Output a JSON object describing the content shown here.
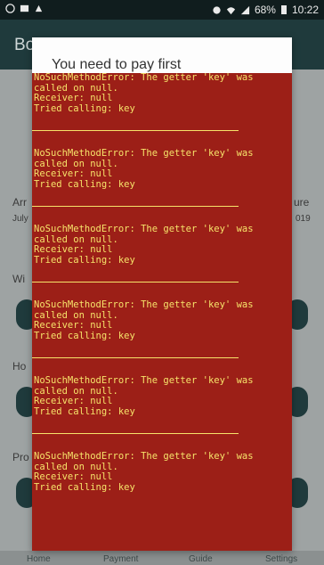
{
  "status_bar": {
    "battery": "68%",
    "time": "10:22"
  },
  "app": {
    "title": "Bo"
  },
  "background": {
    "labels": [
      "Arr",
      "July",
      "ure",
      "019",
      "Wi",
      "Ho",
      "Pro"
    ]
  },
  "bottom_nav": {
    "items": [
      "Home",
      "Payment",
      "Guide",
      "Settings"
    ]
  },
  "dialog": {
    "title": "You need to pay first",
    "errors": [
      "NoSuchMethodError: The getter 'key' was\ncalled on null.\nReceiver: null\nTried calling: key",
      "NoSuchMethodError: The getter 'key' was\ncalled on null.\nReceiver: null\nTried calling: key",
      "NoSuchMethodError: The getter 'key' was\ncalled on null.\nReceiver: null\nTried calling: key",
      "NoSuchMethodError: The getter 'key' was\ncalled on null.\nReceiver: null\nTried calling: key",
      "NoSuchMethodError: The getter 'key' was\ncalled on null.\nReceiver: null\nTried calling: key",
      "NoSuchMethodError: The getter 'key' was\ncalled on null.\nReceiver: null\nTried calling: key"
    ]
  }
}
